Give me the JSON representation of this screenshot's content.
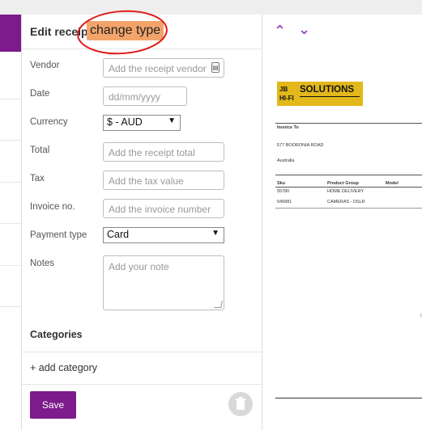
{
  "header": {
    "title": "Edit receipt",
    "change_type_label": "change type"
  },
  "form": {
    "vendor": {
      "label": "Vendor",
      "placeholder": "Add the receipt vendor"
    },
    "date": {
      "label": "Date",
      "placeholder": "dd/mm/yyyy"
    },
    "currency": {
      "label": "Currency",
      "value": "$ - AUD"
    },
    "total": {
      "label": "Total",
      "placeholder": "Add the receipt total"
    },
    "tax": {
      "label": "Tax",
      "placeholder": "Add the tax value"
    },
    "invoice": {
      "label": "Invoice no.",
      "placeholder": "Add the invoice number"
    },
    "payment": {
      "label": "Payment type",
      "value": "Card"
    },
    "notes": {
      "label": "Notes",
      "placeholder": "Add your note"
    }
  },
  "categories": {
    "title": "Categories",
    "add_label": "+ add category"
  },
  "actions": {
    "save_label": "Save"
  },
  "colors": {
    "accent": "#7d1a8c",
    "highlight": "#f3a46b",
    "annotation": "#e11a1a",
    "logo": "#e2b81a"
  },
  "icons": {
    "prev": "chevron-up-icon",
    "next": "chevron-down-icon",
    "trash": "trash-icon",
    "vendor_lookup": "contact-card-icon"
  },
  "preview": {
    "logo_text": "SOLUTIONS",
    "invoice_to": "Invoice To",
    "address_line1": "577 BOORONIA ROAD",
    "address_line2": "Australia",
    "col_sku": "Sku",
    "col_group": "Product Group",
    "col_model": "Model",
    "row1_sku": "55780",
    "row1_group": "HOME DELIVERY",
    "row2_sku": "545881",
    "row2_group": "CAMERAS - DSLR"
  }
}
